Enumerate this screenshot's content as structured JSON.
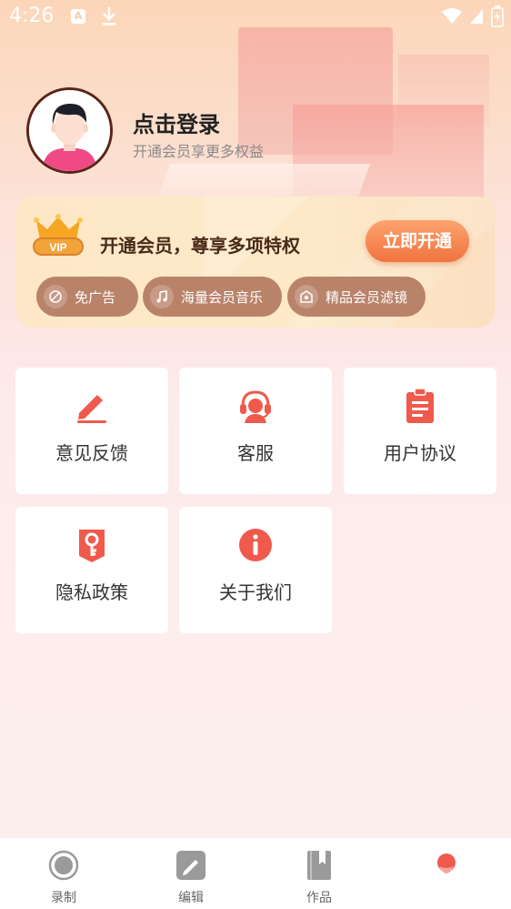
{
  "status_bar": {
    "time": "4:26",
    "a_icon": "A"
  },
  "profile": {
    "title": "点击登录",
    "subtitle": "开通会员享更多权益"
  },
  "vip": {
    "badge": "VIP",
    "title": "开通会员，尊享多项特权",
    "button": "立即开通",
    "perks": [
      {
        "icon": "ad-icon",
        "label": "免广告"
      },
      {
        "icon": "music-note-icon",
        "label": "海量会员音乐"
      },
      {
        "icon": "filter-icon",
        "label": "精品会员滤镜"
      }
    ]
  },
  "menu": [
    {
      "icon": "pencil-icon",
      "label": "意见反馈"
    },
    {
      "icon": "headset-icon",
      "label": "客服"
    },
    {
      "icon": "clipboard-icon",
      "label": "用户协议"
    },
    {
      "icon": "key-icon",
      "label": "隐私政策"
    },
    {
      "icon": "info-icon",
      "label": "关于我们"
    }
  ],
  "nav": [
    {
      "icon": "record-icon",
      "label": "录制"
    },
    {
      "icon": "edit-icon",
      "label": "编辑"
    },
    {
      "icon": "works-icon",
      "label": "作品"
    },
    {
      "icon": "profile-icon",
      "label": ""
    }
  ],
  "colors": {
    "accent": "#ef5a4d",
    "vip_button": "#f0733f",
    "perk_bg": "#b9836a"
  }
}
